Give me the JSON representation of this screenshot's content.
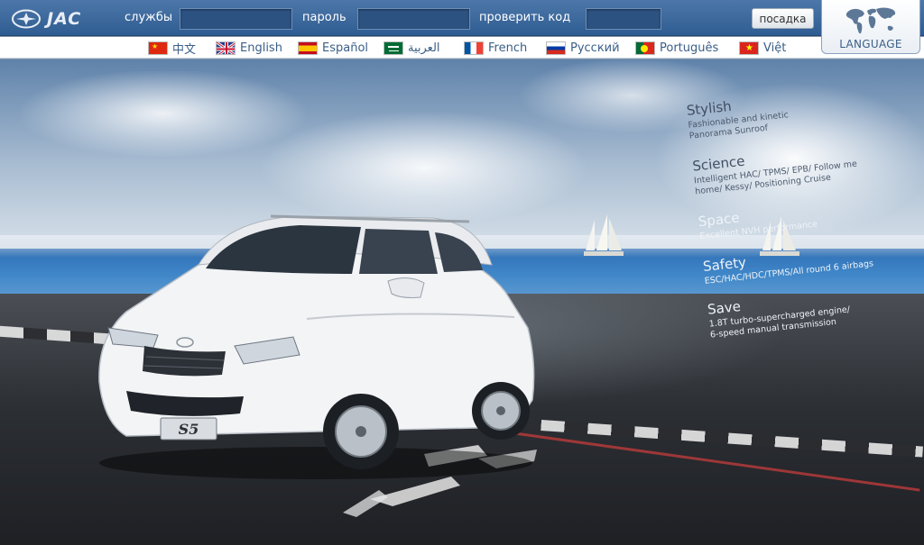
{
  "header": {
    "brand": "JAC",
    "service_label": "службы",
    "password_label": "пароль",
    "captcha_label": "проверить код",
    "service_value": "",
    "password_value": "",
    "captcha_value": "",
    "login_label": "посадка",
    "language_label": "LANGUAGE"
  },
  "languages": [
    {
      "label": "中文",
      "flag": "cn-flag-icon"
    },
    {
      "label": "English",
      "flag": "uk-flag-icon"
    },
    {
      "label": "Español",
      "flag": "es-flag-icon"
    },
    {
      "label": "العربية",
      "flag": "sa-flag-icon"
    },
    {
      "label": "French",
      "flag": "fr-flag-icon"
    },
    {
      "label": "Русский",
      "flag": "ru-flag-icon"
    },
    {
      "label": "Português",
      "flag": "pt-flag-icon"
    },
    {
      "label": "Việt",
      "flag": "vn-flag-icon"
    }
  ],
  "hero": {
    "model_badge": "S5",
    "features": [
      {
        "title": "Stylish",
        "desc": "Fashionable and kinetic\nPanorama Sunroof"
      },
      {
        "title": "Science",
        "desc": "Intelligent HAC/ TPMS/ EPB/ Follow me\nhome/ Kessy/ Positioning Cruise"
      },
      {
        "title": "Space",
        "desc": "Excellent NVH performance"
      },
      {
        "title": "Safety",
        "desc": "ESC/HAC/HDC/TPMS/All round 6 airbags"
      },
      {
        "title": "Save",
        "desc": "1.8T turbo-supercharged engine/\n6-speed manual transmission"
      }
    ]
  },
  "colors": {
    "topbar": "#3d6a9f",
    "accent_text": "#3a5e86",
    "sea": "#3f86c8",
    "road": "#2c2f34"
  }
}
